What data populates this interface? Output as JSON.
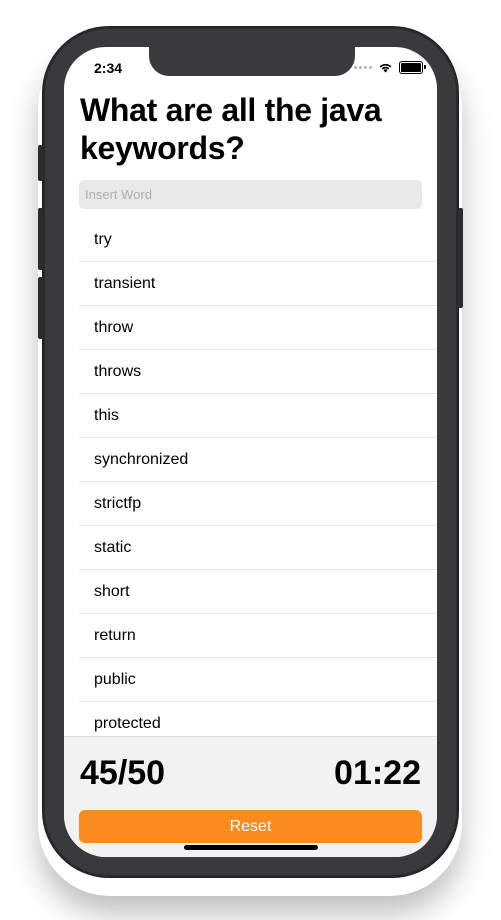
{
  "status_bar": {
    "time": "2:34"
  },
  "title": "What are all the java keywords?",
  "search": {
    "placeholder": "Insert Word",
    "value": ""
  },
  "words": [
    "try",
    "transient",
    "throw",
    "throws",
    "this",
    "synchronized",
    "strictfp",
    "static",
    "short",
    "return",
    "public",
    "protected"
  ],
  "footer": {
    "score": "45/50",
    "timer": "01:22",
    "reset_label": "Reset"
  },
  "colors": {
    "accent": "#fc8b1f",
    "footer_bg": "#f2f2f2",
    "input_bg": "#e8e8e8"
  },
  "icons": [
    "signal-icon",
    "wifi-icon",
    "battery-icon"
  ]
}
